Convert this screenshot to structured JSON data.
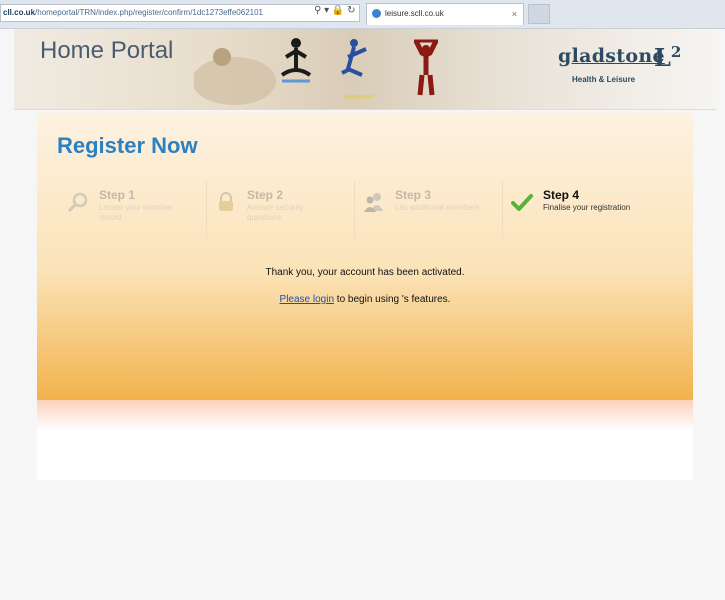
{
  "browser": {
    "url_host": "cll.co.uk",
    "url_path": "/homeportal/TRN/index.php/register/confirm/1dc1273effe062101",
    "tab_title": "leisure.scll.co.uk",
    "tab_close": "×"
  },
  "header": {
    "title": "Home Portal",
    "logo_name": "gladstone",
    "logo_mark": "L",
    "logo_sup": "2",
    "logo_tagline": "Health & Leisure"
  },
  "page": {
    "title": "Register Now",
    "steps": [
      {
        "title": "Step 1",
        "desc": "Locate your member record",
        "icon": "magnifier-icon",
        "active": false
      },
      {
        "title": "Step 2",
        "desc": "Answer security questions",
        "icon": "padlock-icon",
        "active": false
      },
      {
        "title": "Step 3",
        "desc": "List additional members",
        "icon": "people-icon",
        "active": false
      },
      {
        "title": "Step 4",
        "desc": "Finalise your registration",
        "icon": "checkmark-icon",
        "active": true
      }
    ],
    "confirmation": "Thank you, your account has been activated.",
    "login_link": "Please login",
    "login_suffix": " to begin using 's features."
  },
  "colors": {
    "title_blue": "#2b81c3",
    "panel_orange": "#f2b24c",
    "link_blue": "#1b50b3",
    "check_green": "#5bb23a"
  }
}
